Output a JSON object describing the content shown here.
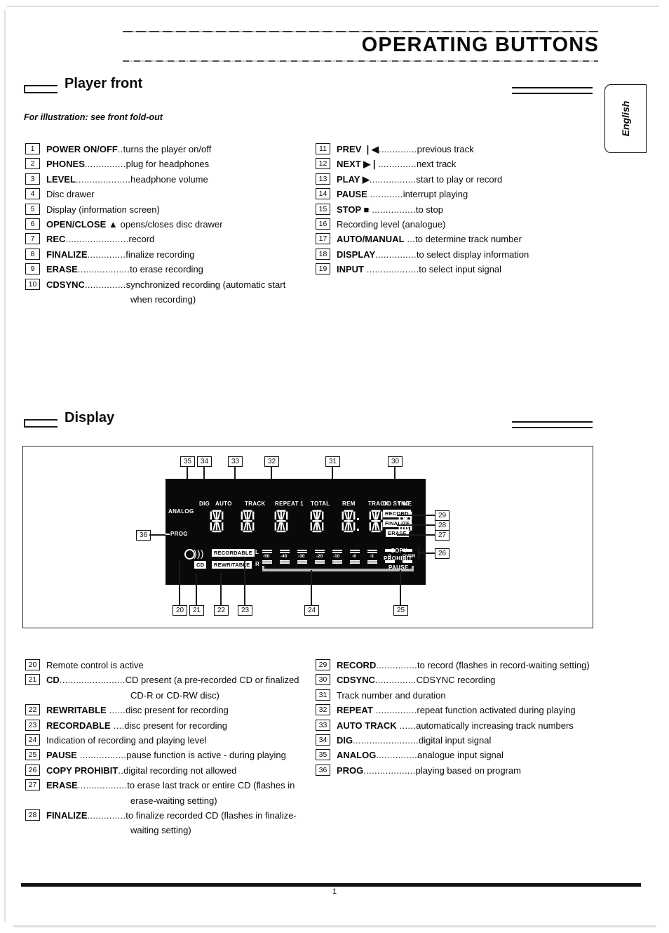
{
  "header": {
    "title": "OPERATING BUTTONS",
    "language_tab": "English"
  },
  "sections": {
    "player_front": {
      "heading": "Player front",
      "note": "For illustration: see front fold-out"
    },
    "display": {
      "heading": "Display"
    }
  },
  "player_front_left": [
    {
      "num": "1",
      "term": "POWER ON/OFF",
      "dots": "..",
      "desc": "turns the player on/off"
    },
    {
      "num": "2",
      "term": "PHONES",
      "dots": "...............",
      "desc": "plug for headphones"
    },
    {
      "num": "3",
      "term": "LEVEL",
      "dots": "....................",
      "desc": "headphone volume"
    },
    {
      "num": "4",
      "term": "",
      "dots": "",
      "desc": "Disc drawer"
    },
    {
      "num": "5",
      "term": "",
      "dots": "",
      "desc": "Display (information screen)"
    },
    {
      "num": "6",
      "term": "OPEN/CLOSE ▲",
      "dots": "  ",
      "desc": "opens/closes disc drawer"
    },
    {
      "num": "7",
      "term": "REC",
      "dots": ".......................",
      "desc": "record"
    },
    {
      "num": "8",
      "term": "FINALIZE",
      "dots": "..............",
      "desc": "finalize recording"
    },
    {
      "num": "9",
      "term": "ERASE",
      "dots": "...................",
      "desc": "to erase recording"
    },
    {
      "num": "10",
      "term": "CDSYNC",
      "dots": "...............",
      "desc": "synchronized recording (automatic start",
      "cont": "when recording)"
    }
  ],
  "player_front_right": [
    {
      "num": "11",
      "term": "PREV ❘◀",
      "dots": "..............",
      "desc": "previous track"
    },
    {
      "num": "12",
      "term": "NEXT ▶❘",
      "dots": "..............",
      "desc": "next track"
    },
    {
      "num": "13",
      "term": "PLAY ▶",
      "dots": ".................",
      "desc": "start to play or record"
    },
    {
      "num": "14",
      "term": "PAUSE",
      "dots": "     ............",
      "desc": "interrupt playing"
    },
    {
      "num": "15",
      "term": "STOP ■",
      "dots": " ................",
      "desc": "to stop"
    },
    {
      "num": "16",
      "term": "",
      "dots": "",
      "desc": "Recording level (analogue)"
    },
    {
      "num": "17",
      "term": "AUTO/MANUAL",
      "dots": " ...",
      "desc": "to determine track number"
    },
    {
      "num": "18",
      "term": "DISPLAY",
      "dots": "...............",
      "desc": "to select display information"
    },
    {
      "num": "19",
      "term": "INPUT",
      "dots": " ...................",
      "desc": "to select input signal"
    }
  ],
  "display_left": [
    {
      "num": "20",
      "term": "",
      "dots": "",
      "desc": "Remote control is active"
    },
    {
      "num": "21",
      "term": "CD",
      "dots": "........................",
      "desc": "CD present (a pre-recorded CD or finalized",
      "cont": "CD-R or CD-RW disc)"
    },
    {
      "num": "22",
      "term": "REWRITABLE",
      "dots": " ......",
      "desc": "disc present for recording"
    },
    {
      "num": "23",
      "term": "RECORDABLE",
      "dots": " ....",
      "desc": "disc present for recording"
    },
    {
      "num": "24",
      "term": "",
      "dots": "",
      "desc": "Indication of recording and playing level"
    },
    {
      "num": "25",
      "term": "PAUSE",
      "dots": " .................",
      "desc": "pause function is active - during playing"
    },
    {
      "num": "26",
      "term": "COPY PROHIBIT",
      "dots": "..",
      "desc": "digital recording not allowed"
    },
    {
      "num": "27",
      "term": "ERASE",
      "dots": "..................",
      "desc": "to erase last track or entire CD (flashes in",
      "cont": "erase-waiting setting)"
    },
    {
      "num": "28",
      "term": "FINALIZE",
      "dots": "..............",
      "desc": "to finalize recorded CD (flashes in finalize-",
      "cont": "waiting setting)"
    }
  ],
  "display_right": [
    {
      "num": "29",
      "term": "RECORD",
      "dots": "...............",
      "desc": "to record (flashes in record-waiting setting)"
    },
    {
      "num": "30",
      "term": "CDSYNC",
      "dots": "...............",
      "desc": "CDSYNC recording"
    },
    {
      "num": "31",
      "term": "",
      "dots": "",
      "desc": "Track number and duration"
    },
    {
      "num": "32",
      "term": "REPEAT",
      "dots": " ...............",
      "desc": "repeat function activated during playing"
    },
    {
      "num": "33",
      "term": "AUTO TRACK",
      "dots": " ......",
      "desc": "automatically increasing track numbers"
    },
    {
      "num": "34",
      "term": "DIG",
      "dots": "........................",
      "desc": "digital input signal"
    },
    {
      "num": "35",
      "term": "ANALOG",
      "dots": "...............",
      "desc": "analogue input signal"
    },
    {
      "num": "36",
      "term": "PROG",
      "dots": "...................",
      "desc": "playing based on program"
    }
  ],
  "display_panel": {
    "indicators_top": [
      "DIG",
      "AUTO",
      "TRACK",
      "REPEAT 1",
      "TOTAL",
      "REM",
      "TRACK",
      "TIME",
      "CD SYNC"
    ],
    "analog_label": "ANALOG",
    "prog_label": "PROG",
    "disc_labels": [
      "CD",
      "RECORDABLE",
      "REWRITABLE"
    ],
    "status_labels": [
      "RECORD",
      "FINALIZE",
      "ERASE"
    ],
    "right_labels": [
      "COPY",
      "PROHIBIT",
      "PAUSE"
    ],
    "channel_labels": [
      "L",
      "R"
    ],
    "meter_scale": [
      "-50",
      "-40",
      "-30",
      "-20",
      "-10",
      "-6",
      "-3",
      "0",
      "OVER"
    ],
    "digit_count": 7
  },
  "callouts_top": [
    "35",
    "34",
    "33",
    "32",
    "31",
    "30"
  ],
  "callouts_right": [
    "29",
    "28",
    "27",
    "26"
  ],
  "callouts_bottom": [
    "20",
    "21",
    "22",
    "23",
    "24",
    "25"
  ],
  "callout_left": "36",
  "footer": {
    "page_number": "1"
  },
  "colors": {
    "ink": "#0a0a0a",
    "panel_background": "#090909",
    "panel_text": "#ffffff",
    "paper": "#ffffff"
  }
}
